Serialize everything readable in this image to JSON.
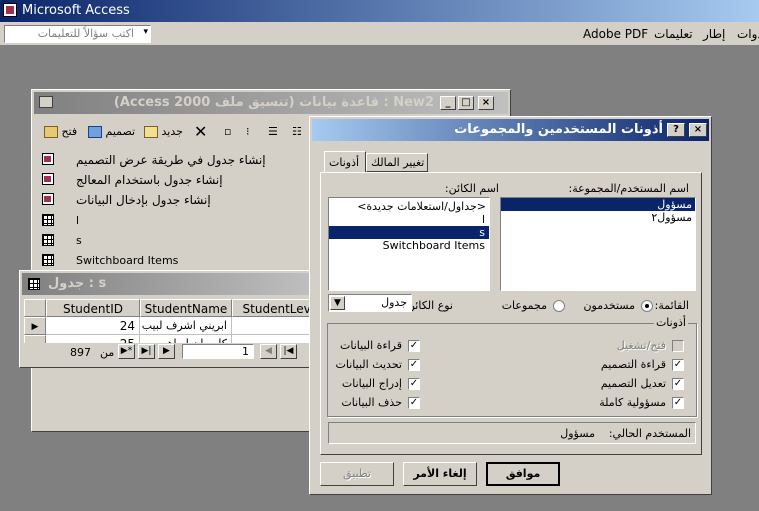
{
  "app": {
    "title": "Microsoft Access",
    "help_placeholder": "اكتب سؤالاً للتعليمات"
  },
  "menu": {
    "items": [
      "أدوات",
      "إطار",
      "تعليمات",
      "Adobe PDF"
    ]
  },
  "db_window": {
    "title": "New2 : قاعدة بيانات (تنسيق ملف Access 2000)",
    "toolbar": {
      "open": "فتح",
      "design": "تصميم",
      "new": "جديد"
    },
    "items": [
      {
        "label": "إنشاء جدول في طريقة عرض التصميم",
        "icon": "wizard-icon"
      },
      {
        "label": "إنشاء جدول باستخدام المعالج",
        "icon": "wizard-icon"
      },
      {
        "label": "إنشاء جدول بإدخال البيانات",
        "icon": "wizard-icon"
      },
      {
        "label": "l",
        "icon": "table-icon"
      },
      {
        "label": "s",
        "icon": "table-icon"
      },
      {
        "label": "Switchboard Items",
        "icon": "table-icon"
      }
    ]
  },
  "table_window": {
    "title": "s : جدول",
    "columns": [
      "StudentID",
      "StudentName",
      "StudentLevel"
    ],
    "rows": [
      {
        "id": "24",
        "name": "ابريني اشرف لبيب"
      },
      {
        "id": "25",
        "name": "كاريمان ابراهيم"
      }
    ],
    "nav": {
      "record": "1",
      "of_label": "من",
      "total": "897"
    }
  },
  "dialog": {
    "title": "أذونات المستخدمين والمجموعات",
    "tabs": [
      "أذونات",
      "تغيير المالك"
    ],
    "user_group_label": "اسم المستخدم/المجموعة:",
    "users": [
      "مسؤول",
      "مسؤول٢"
    ],
    "selected_user": "مسؤول",
    "object_label": "اسم الكائن:",
    "objects": [
      "<جداول/استعلامات جديدة>",
      "l",
      "s",
      "Switchboard Items"
    ],
    "selected_object": "s",
    "list_label": "القائمة:",
    "radio_users": "مستخدمون",
    "radio_groups": "مجموعات",
    "object_type_label": "نوع الكائن:",
    "object_type": "جدول",
    "permissions_group": "أذونات",
    "permissions": {
      "open_run": "فتح/تشغيل",
      "read_design": "قراءة التصميم",
      "modify_design": "تعديل التصميم",
      "administer": "مسؤولية كاملة",
      "read_data": "قراءة البيانات",
      "update_data": "تحديث البيانات",
      "insert_data": "إدراج البيانات",
      "delete_data": "حذف البيانات"
    },
    "current_user_label": "المستخدم الحالي:",
    "current_user": "مسؤول",
    "ok": "موافق",
    "cancel": "إلغاء الأمر",
    "apply": "تطبيق"
  }
}
